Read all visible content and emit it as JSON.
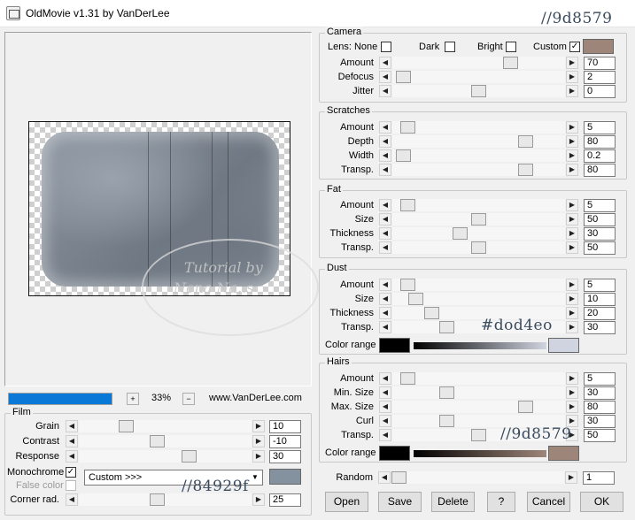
{
  "window": {
    "title": "OldMovie v1.31 by VanDerLee"
  },
  "notes": {
    "top_hex": "//9d8579",
    "dust_hex": "#dod4eo",
    "hairs_hex": "//9d8579",
    "film_hex": "//84929f"
  },
  "watermark": {
    "line1": "Tutorial by",
    "line2": "Nena Na..s"
  },
  "preview": {
    "progress": 1.0,
    "zoom": "33%",
    "site": "www.VanDerLee.com",
    "plus": "+",
    "minus": "−"
  },
  "camera": {
    "title": "Camera",
    "lens_label": "Lens: None",
    "dark_label": "Dark",
    "bright_label": "Bright",
    "custom_label": "Custom",
    "lens_checked": false,
    "dark_checked": false,
    "bright_checked": false,
    "custom_checked": true,
    "custom_color": "#9d8579",
    "sliders": [
      {
        "label": "Amount",
        "value": "70",
        "pos": 0.7
      },
      {
        "label": "Defocus",
        "value": "2",
        "pos": 0.02
      },
      {
        "label": "Jitter",
        "value": "0",
        "pos": 0.5
      }
    ]
  },
  "scratches": {
    "title": "Scratches",
    "sliders": [
      {
        "label": "Amount",
        "value": "5",
        "pos": 0.05
      },
      {
        "label": "Depth",
        "value": "80",
        "pos": 0.8
      },
      {
        "label": "Width",
        "value": "0.2",
        "pos": 0.02
      },
      {
        "label": "Transp.",
        "value": "80",
        "pos": 0.8
      }
    ]
  },
  "fat": {
    "title": "Fat",
    "sliders": [
      {
        "label": "Amount",
        "value": "5",
        "pos": 0.05
      },
      {
        "label": "Size",
        "value": "50",
        "pos": 0.5
      },
      {
        "label": "Thickness",
        "value": "30",
        "pos": 0.38
      },
      {
        "label": "Transp.",
        "value": "50",
        "pos": 0.5
      }
    ]
  },
  "dust": {
    "title": "Dust",
    "sliders": [
      {
        "label": "Amount",
        "value": "5",
        "pos": 0.05
      },
      {
        "label": "Size",
        "value": "10",
        "pos": 0.1
      },
      {
        "label": "Thickness",
        "value": "20",
        "pos": 0.2
      },
      {
        "label": "Transp.",
        "value": "30",
        "pos": 0.3
      }
    ],
    "color_range_label": "Color range",
    "color_from": "#000000",
    "color_to": "#d0d4e0"
  },
  "hairs": {
    "title": "Hairs",
    "sliders": [
      {
        "label": "Amount",
        "value": "5",
        "pos": 0.05
      },
      {
        "label": "Min. Size",
        "value": "30",
        "pos": 0.3
      },
      {
        "label": "Max. Size",
        "value": "80",
        "pos": 0.8
      },
      {
        "label": "Curl",
        "value": "30",
        "pos": 0.3
      },
      {
        "label": "Transp.",
        "value": "50",
        "pos": 0.5
      }
    ],
    "color_range_label": "Color range",
    "color_from": "#000000",
    "color_to": "#9d8579"
  },
  "film": {
    "title": "Film",
    "sliders": [
      {
        "label": "Grain",
        "value": "10",
        "pos": 0.25
      },
      {
        "label": "Contrast",
        "value": "-10",
        "pos": 0.45
      },
      {
        "label": "Response",
        "value": "30",
        "pos": 0.65
      }
    ],
    "monochrome_label": "Monochrome",
    "monochrome_checked": true,
    "false_color_label": "False color",
    "false_color_checked": false,
    "preset_value": "Custom >>>",
    "mono_color": "#84929f",
    "corner_label": "Corner rad.",
    "corner_value": "25",
    "corner_pos": 0.45
  },
  "random": {
    "label": "Random",
    "value": "1",
    "pos": 0.0
  },
  "buttons": {
    "open": "Open",
    "save": "Save",
    "delete": "Delete",
    "help": "?",
    "cancel": "Cancel",
    "ok": "OK"
  }
}
